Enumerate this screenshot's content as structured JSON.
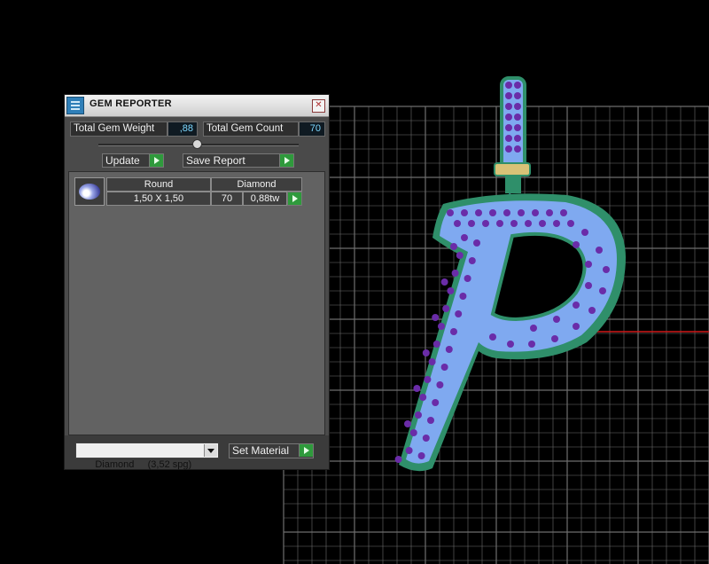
{
  "panel": {
    "title": "GEM REPORTER",
    "close_label": "✕",
    "total_weight_label": "Total Gem Weight",
    "total_weight_value": ",88",
    "total_count_label": "Total Gem Count",
    "total_count_value": "70",
    "update_label": "Update",
    "save_report_label": "Save Report",
    "table": {
      "header": [
        "Round",
        "Diamond"
      ],
      "row": {
        "size": "1,50 X 1,50",
        "count": "70",
        "weight": "0,88tw"
      }
    },
    "material_select": "Diamond     (3,52 spg)",
    "set_material_label": "Set Material"
  },
  "colors": {
    "background": "#000000",
    "grid": "#6e6e6e",
    "gem_body": "#7fa9f0",
    "gem_stones": "#6a2ca8",
    "setting_rim": "#2f8f6a",
    "axis_red": "#d01818",
    "axis_cyan": "#2ec8d0",
    "accent_go": "#2f9a3c",
    "value_text": "#7dd8ff"
  }
}
